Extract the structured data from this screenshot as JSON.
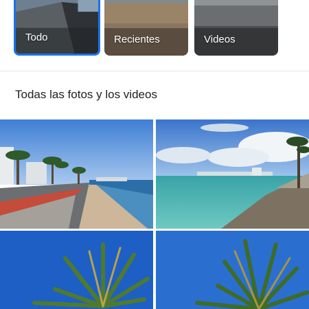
{
  "filters": [
    {
      "label": "Todo",
      "selected": true
    },
    {
      "label": "Recientes",
      "selected": false
    },
    {
      "label": "Videos",
      "selected": false
    }
  ],
  "section": {
    "title": "Todas las fotos y los videos"
  },
  "colors": {
    "accent": "#1a73e8",
    "divider": "#e6e6e6",
    "title_text": "#202124"
  },
  "photos": [
    {
      "subject": "beachfront-seawall-with-palms"
    },
    {
      "subject": "turquoise-sea-and-stone-wall"
    },
    {
      "subject": "palm-tree-blue-sky"
    },
    {
      "subject": "palm-tree-blue-sky-2"
    }
  ]
}
